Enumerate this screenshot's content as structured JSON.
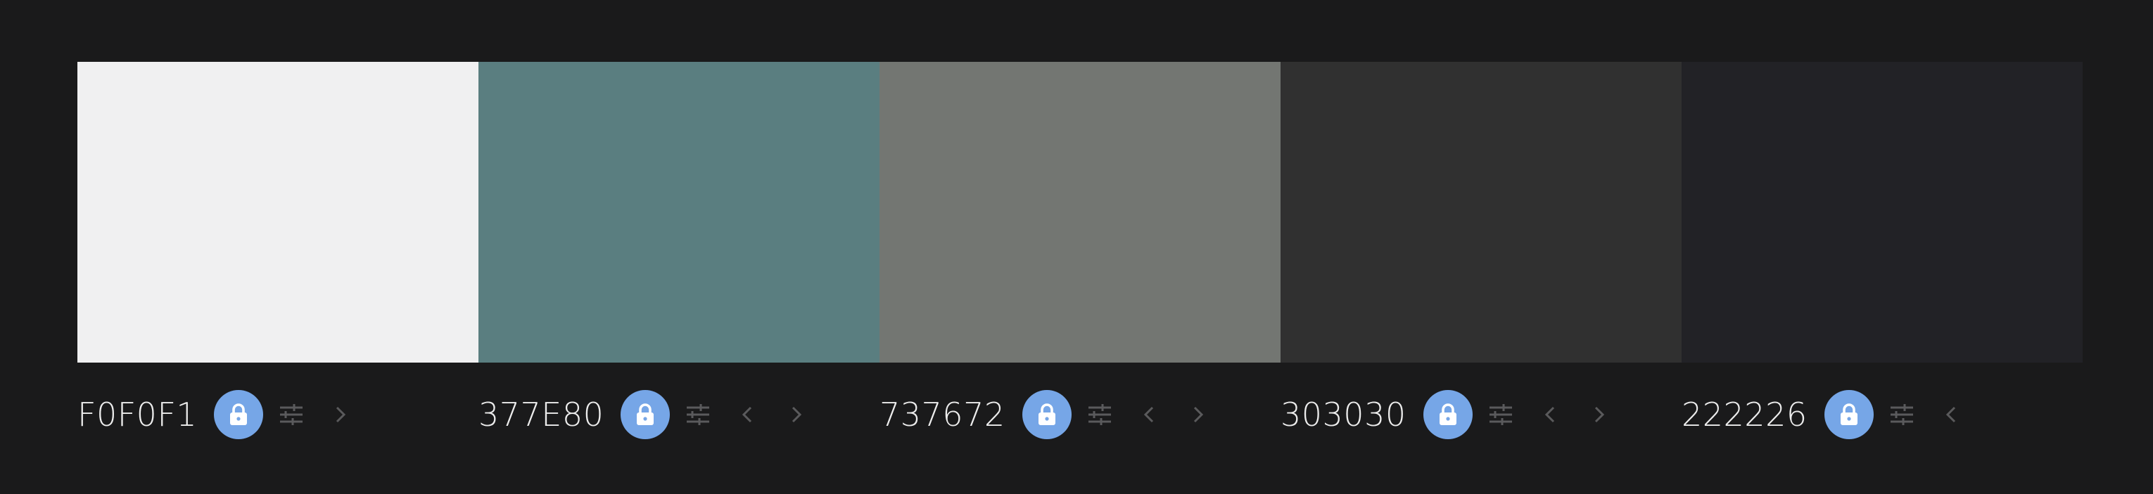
{
  "colors": [
    {
      "hex": "F0F0F1",
      "value": "#F0F0F1",
      "locked": true,
      "prev": false,
      "next": true
    },
    {
      "hex": "377E80",
      "value": "#5A7E80",
      "locked": true,
      "prev": true,
      "next": true
    },
    {
      "hex": "737672",
      "value": "#737672",
      "locked": true,
      "prev": true,
      "next": true
    },
    {
      "hex": "303030",
      "value": "#303030",
      "locked": true,
      "prev": true,
      "next": true
    },
    {
      "hex": "222226",
      "value": "#222226",
      "locked": true,
      "prev": true,
      "next": false
    }
  ],
  "theme": {
    "background": "#1a1a1b",
    "lock_button": "#76a6e7",
    "icon_muted": "#5a5a5c"
  },
  "icons": {
    "lock": "lock-icon",
    "adjust": "sliders-icon",
    "prev": "chevron-left-icon",
    "next": "chevron-right-icon"
  }
}
